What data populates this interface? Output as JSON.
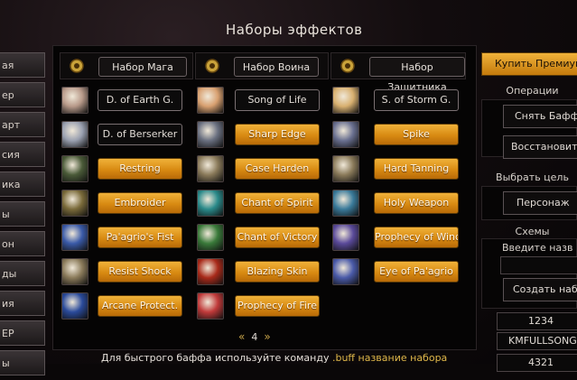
{
  "title": "Наборы эффектов",
  "left_nav": [
    "ая",
    "ер",
    "арт",
    "сия",
    "ика",
    "ы",
    "он",
    "ды",
    "ия",
    "ЕР",
    "ы"
  ],
  "columns": [
    {
      "header": "Набор Мага",
      "icon": "wand-icon",
      "items": [
        {
          "label": "D. of Earth G.",
          "style": "dark",
          "icon": "earth-guardian-icon",
          "color": "#b89a8a"
        },
        {
          "label": "D. of Berserker",
          "style": "dark",
          "icon": "berserker-icon",
          "color": "#9aa0b0"
        },
        {
          "label": "Restring",
          "style": "gold",
          "icon": "restring-icon",
          "color": "#4a5a38"
        },
        {
          "label": "Embroider",
          "style": "gold",
          "icon": "embroider-icon",
          "color": "#7a6a3a"
        },
        {
          "label": "Pa'agrio's Fist",
          "style": "gold",
          "icon": "paagrio-fist-icon",
          "color": "#3a5aa8"
        },
        {
          "label": "Resist Shock",
          "style": "gold",
          "icon": "resist-shock-icon",
          "color": "#8a7a5a"
        },
        {
          "label": "Arcane Protect.",
          "style": "gold",
          "icon": "arcane-protect-icon",
          "color": "#2a4a9a"
        }
      ]
    },
    {
      "header": "Набор Воина",
      "icon": "warrior-crest-icon",
      "items": [
        {
          "label": "Song of Life",
          "style": "dark",
          "icon": "song-of-life-icon",
          "color": "#d8a070"
        },
        {
          "label": "Sharp Edge",
          "style": "gold",
          "icon": "sharp-edge-icon",
          "color": "#6a7080"
        },
        {
          "label": "Case Harden",
          "style": "gold",
          "icon": "case-harden-icon",
          "color": "#8a7a5a"
        },
        {
          "label": "Chant of Spirit",
          "style": "gold",
          "icon": "chant-of-spirit-icon",
          "color": "#2a8a8a"
        },
        {
          "label": "Chant of Victory",
          "style": "gold",
          "icon": "chant-of-victory-icon",
          "color": "#3a7a3a"
        },
        {
          "label": "Blazing Skin",
          "style": "gold",
          "icon": "blazing-skin-icon",
          "color": "#a82a1a"
        },
        {
          "label": "Prophecy of Fire",
          "style": "gold",
          "icon": "prophecy-of-fire-icon",
          "color": "#c03a3a"
        }
      ]
    },
    {
      "header": "Набор Защитника",
      "icon": "sun-emblem-icon",
      "items": [
        {
          "label": "S. of Storm G.",
          "style": "dark",
          "icon": "storm-guardian-icon",
          "color": "#d8b070"
        },
        {
          "label": "Spike",
          "style": "gold",
          "icon": "spike-icon",
          "color": "#6a7090"
        },
        {
          "label": "Hard Tanning",
          "style": "gold",
          "icon": "hard-tanning-icon",
          "color": "#8a7a5a"
        },
        {
          "label": "Holy Weapon",
          "style": "gold",
          "icon": "holy-weapon-icon",
          "color": "#3a7a9a"
        },
        {
          "label": "Prophecy of Wind",
          "style": "gold",
          "icon": "prophecy-of-wind-icon",
          "color": "#5a4a9a"
        },
        {
          "label": "Eye of Pa'agrio",
          "style": "gold",
          "icon": "eye-of-paagrio-icon",
          "color": "#4a5aa8"
        }
      ]
    }
  ],
  "pager": {
    "prev": "«",
    "page": "4",
    "next": "»"
  },
  "footer": {
    "text": "Для быстрого баффа используйте команду",
    "command": ".buff название набора"
  },
  "right": {
    "premium_button": "Купить Премиум-",
    "operations_label": "Операции",
    "remove_buffs": "Снять Баффы",
    "restore": "Восстановить",
    "choose_target_label": "Выбрать цель",
    "target_button": "Персонаж",
    "schemes_label": "Схемы",
    "enter_name_label": "Введите назв",
    "name_input_value": "",
    "create_button": "Создать набо",
    "schemes": [
      "1234",
      "KMFULLSONG",
      "4321"
    ]
  }
}
